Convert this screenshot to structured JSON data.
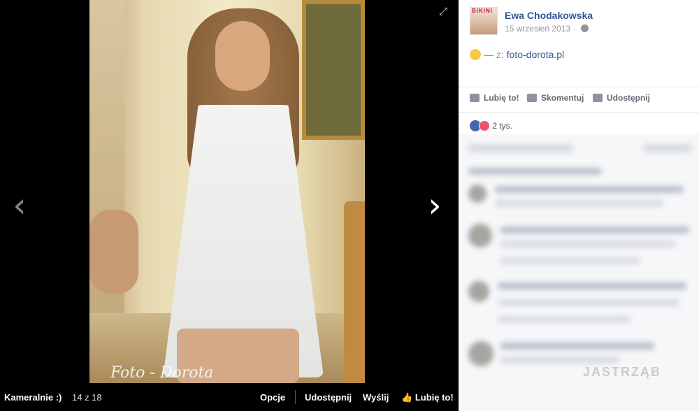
{
  "viewer": {
    "photo_watermark": "Foto - Dorota",
    "nav_prev": "‹",
    "nav_next": "›",
    "expand_icon": "expand-icon"
  },
  "bottombar": {
    "title": "Kameralnie :)",
    "counter": "14 z 18",
    "options_label": "Opcje",
    "share_label": "Udostępnij",
    "send_label": "Wyślij",
    "like_label": "Lubię to!"
  },
  "post": {
    "author": "Ewa Chodakowska",
    "date": "15 wrzesień 2013 ·",
    "avatar_logo": "BIKINI",
    "caption_prefix": "— z: ",
    "caption_link": "foto-dorota.pl"
  },
  "actions": {
    "like": "Lubię to!",
    "comment": "Skomentuj",
    "share": "Udostępnij"
  },
  "reactions": {
    "count": "2 tys."
  },
  "colors": {
    "link_blue": "#365899",
    "muted_gray": "#90949c",
    "like_blue": "#4267b2",
    "love_red": "#f25268"
  },
  "corner_watermark": "JASTRZĄB"
}
